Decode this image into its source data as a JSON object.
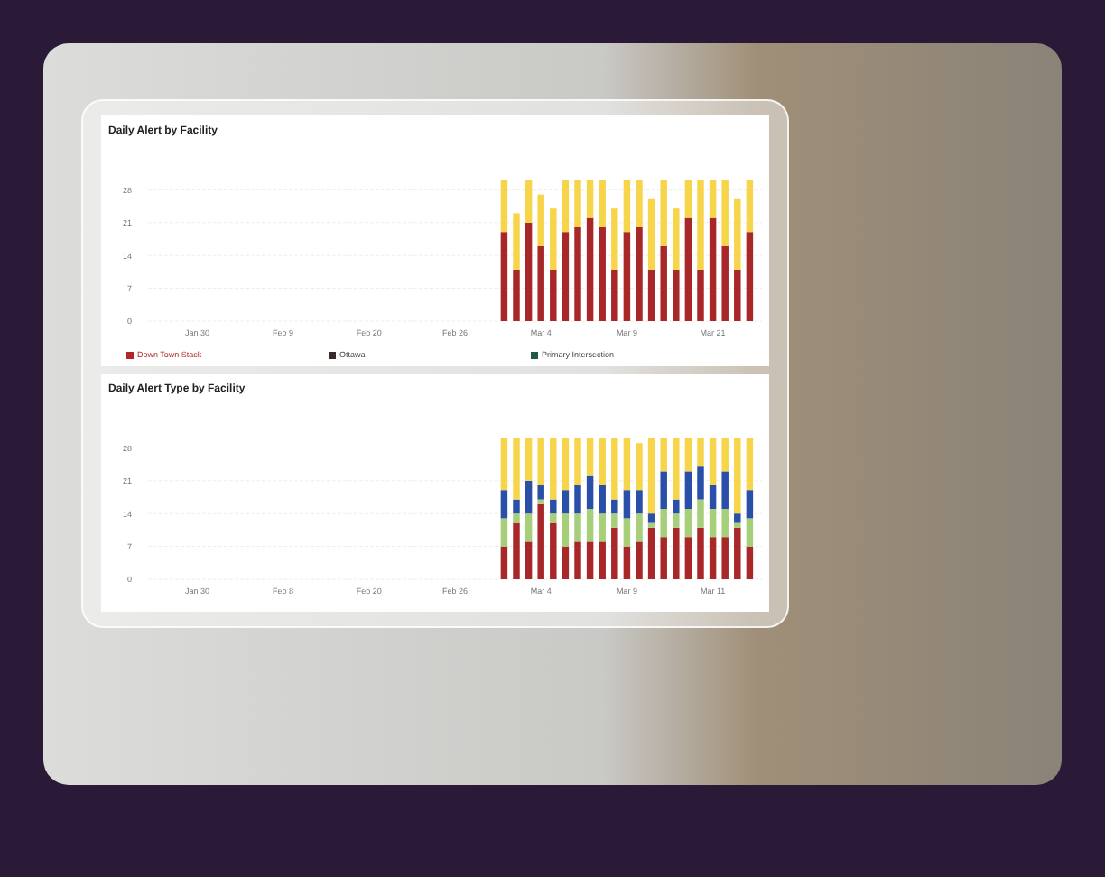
{
  "dashboard": {
    "panels": [
      {
        "title": "Daily Alert by Facility",
        "legend": [
          {
            "name": "Down Town Stack",
            "color": "#b0282a"
          },
          {
            "name": "Ottawa",
            "color": "#3a2a2a"
          },
          {
            "name": "Primary Intersection",
            "color": "#1f5a44"
          }
        ],
        "chart_data": {
          "type": "bar",
          "stacked": true,
          "grid": true,
          "ylim": [
            0,
            30
          ],
          "yticks": [
            0,
            7,
            14,
            21,
            28
          ],
          "categories": [
            null,
            null,
            null,
            "Jan 30",
            null,
            null,
            null,
            null,
            null,
            null,
            "Feb 9",
            null,
            null,
            null,
            null,
            null,
            null,
            "Feb 20",
            null,
            null,
            null,
            null,
            null,
            null,
            "Feb 26",
            null,
            null,
            null,
            null,
            null,
            null,
            "Mar 4",
            null,
            null,
            null,
            null,
            null,
            null,
            "Mar 9",
            null,
            null,
            null,
            null,
            null,
            null,
            "Mar 21",
            null,
            null,
            null
          ],
          "series": [
            {
              "color": "#a8282a",
              "values": [
                null,
                null,
                null,
                null,
                null,
                null,
                null,
                null,
                null,
                null,
                null,
                null,
                null,
                null,
                null,
                null,
                null,
                null,
                null,
                null,
                null,
                null,
                null,
                null,
                null,
                null,
                null,
                null,
                19,
                11,
                21,
                16,
                11,
                19,
                20,
                22,
                20,
                11,
                19,
                20,
                11,
                16,
                11,
                22,
                11,
                22,
                16,
                11,
                19
              ]
            },
            {
              "color": "#f7d54a",
              "values": [
                null,
                null,
                null,
                null,
                null,
                null,
                null,
                null,
                null,
                null,
                null,
                null,
                null,
                null,
                null,
                null,
                null,
                null,
                null,
                null,
                null,
                null,
                null,
                null,
                null,
                null,
                null,
                null,
                11,
                12,
                9,
                11,
                13,
                11,
                10,
                8,
                10,
                13,
                11,
                10,
                15,
                14,
                13,
                8,
                19,
                8,
                14,
                15,
                11
              ]
            }
          ]
        }
      },
      {
        "title": "Daily Alert Type by Facility",
        "chart_data": {
          "type": "bar",
          "stacked": true,
          "grid": true,
          "ylim": [
            0,
            30
          ],
          "yticks": [
            0,
            7,
            14,
            21,
            28
          ],
          "categories": [
            null,
            null,
            null,
            "Jan 30",
            null,
            null,
            null,
            null,
            null,
            null,
            "Feb 8",
            null,
            null,
            null,
            null,
            null,
            null,
            "Feb 20",
            null,
            null,
            null,
            null,
            null,
            null,
            "Feb 26",
            null,
            null,
            null,
            null,
            null,
            null,
            "Mar 4",
            null,
            null,
            null,
            null,
            null,
            null,
            "Mar 9",
            null,
            null,
            null,
            null,
            null,
            null,
            "Mar 11",
            null,
            null,
            null
          ],
          "series": [
            {
              "color": "#a8282a",
              "values": [
                null,
                null,
                null,
                null,
                null,
                null,
                null,
                null,
                null,
                null,
                null,
                null,
                null,
                null,
                null,
                null,
                null,
                null,
                null,
                null,
                null,
                null,
                null,
                null,
                null,
                null,
                null,
                null,
                7,
                12,
                8,
                16,
                12,
                7,
                8,
                8,
                8,
                11,
                7,
                8,
                11,
                9,
                11,
                9,
                11,
                9,
                9,
                11,
                7
              ]
            },
            {
              "color": "#a7cf7a",
              "values": [
                null,
                null,
                null,
                null,
                null,
                null,
                null,
                null,
                null,
                null,
                null,
                null,
                null,
                null,
                null,
                null,
                null,
                null,
                null,
                null,
                null,
                null,
                null,
                null,
                null,
                null,
                null,
                null,
                6,
                2,
                6,
                1,
                2,
                7,
                6,
                7,
                6,
                3,
                6,
                6,
                1,
                6,
                3,
                6,
                6,
                6,
                6,
                1,
                6
              ]
            },
            {
              "color": "#2a4fa8",
              "values": [
                null,
                null,
                null,
                null,
                null,
                null,
                null,
                null,
                null,
                null,
                null,
                null,
                null,
                null,
                null,
                null,
                null,
                null,
                null,
                null,
                null,
                null,
                null,
                null,
                null,
                null,
                null,
                null,
                6,
                3,
                7,
                3,
                3,
                5,
                6,
                7,
                6,
                3,
                6,
                5,
                2,
                8,
                3,
                8,
                7,
                5,
                8,
                2,
                6
              ]
            },
            {
              "color": "#f7d54a",
              "values": [
                null,
                null,
                null,
                null,
                null,
                null,
                null,
                null,
                null,
                null,
                null,
                null,
                null,
                null,
                null,
                null,
                null,
                null,
                null,
                null,
                null,
                null,
                null,
                null,
                null,
                null,
                null,
                null,
                11,
                13,
                9,
                10,
                13,
                11,
                10,
                8,
                10,
                13,
                11,
                10,
                16,
                7,
                13,
                7,
                6,
                10,
                7,
                16,
                11
              ]
            }
          ]
        }
      }
    ]
  }
}
